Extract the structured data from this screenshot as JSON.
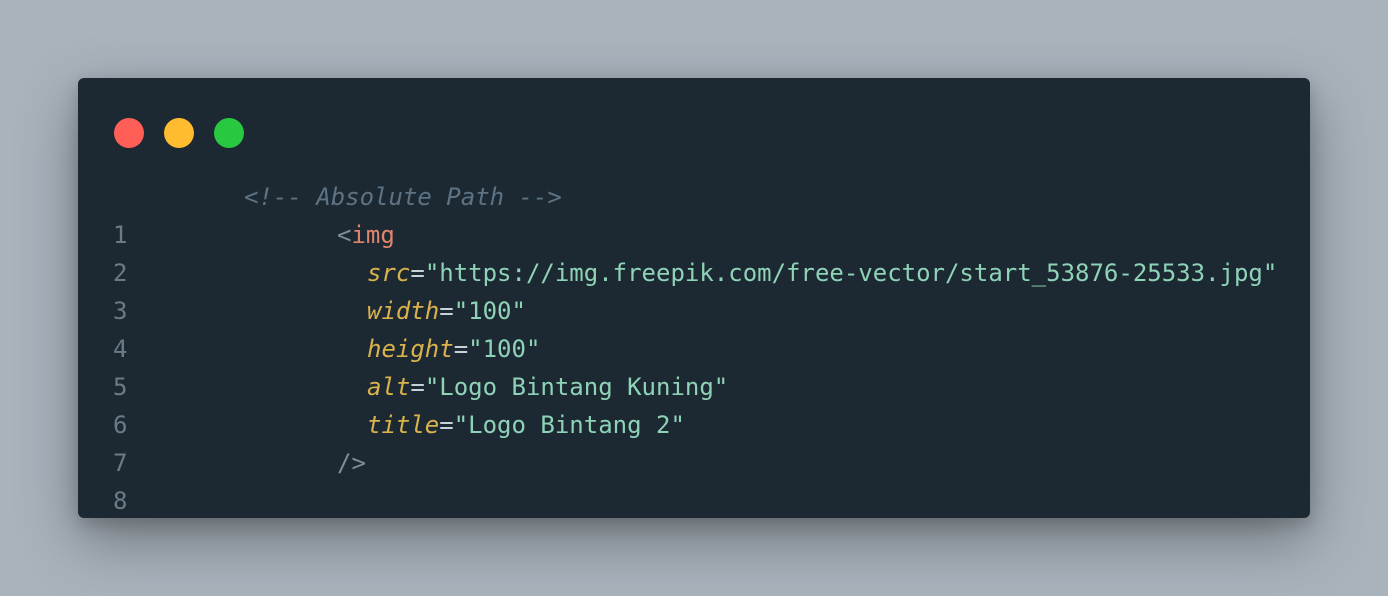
{
  "window": {
    "controls": {
      "close_color": "#ff5f57",
      "minimize_color": "#febc2e",
      "maximize_color": "#28c840"
    }
  },
  "code": {
    "line_numbers": [
      "1",
      "2",
      "3",
      "4",
      "5",
      "6",
      "7",
      "8"
    ],
    "comment": "<!-- Absolute Path -->",
    "tag_open_bracket": "<",
    "tag_name": "img",
    "attributes": [
      {
        "name": "src",
        "equals": "=",
        "value": "\"https://img.freepik.com/free-vector/start_53876-25533.jpg\""
      },
      {
        "name": "width",
        "equals": "=",
        "value": "\"100\""
      },
      {
        "name": "height",
        "equals": "=",
        "value": "\"100\""
      },
      {
        "name": "alt",
        "equals": "=",
        "value": "\"Logo Bintang Kuning\""
      },
      {
        "name": "title",
        "equals": "=",
        "value": "\"Logo Bintang 2\""
      }
    ],
    "tag_close": "/>"
  },
  "colors": {
    "background": "#a9b3bc",
    "editor_background": "#1c2933",
    "comment": "#5d7384",
    "tag": "#e0856d",
    "attribute": "#d9b24c",
    "string": "#8fd3b7",
    "line_number": "#6b7b87"
  }
}
